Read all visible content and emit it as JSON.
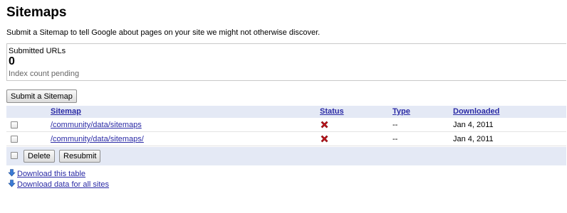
{
  "page": {
    "title": "Sitemaps",
    "intro": "Submit a Sitemap to tell Google about pages on your site we might not otherwise discover."
  },
  "summary": {
    "label": "Submitted URLs",
    "count": "0",
    "note": "Index count pending"
  },
  "actions": {
    "submit_label": "Submit a Sitemap",
    "delete_label": "Delete",
    "resubmit_label": "Resubmit"
  },
  "table": {
    "columns": {
      "sitemap": "Sitemap",
      "status": "Status",
      "type": "Type",
      "downloaded": "Downloaded"
    },
    "rows": [
      {
        "sitemap": "/community/data/sitemaps",
        "status": "error-x-icon",
        "type": "--",
        "downloaded": "Jan 4, 2011"
      },
      {
        "sitemap": "/community/data/sitemaps/",
        "status": "error-x-icon",
        "type": "--",
        "downloaded": "Jan 4, 2011"
      }
    ]
  },
  "downloads": {
    "table_label": "Download this table",
    "all_sites_label": "Download data for all sites",
    "icon": "download-arrow-icon"
  },
  "colors": {
    "link": "#2a2aa5",
    "header_bg": "#e4e9f5",
    "error_red": "#c0141b"
  }
}
